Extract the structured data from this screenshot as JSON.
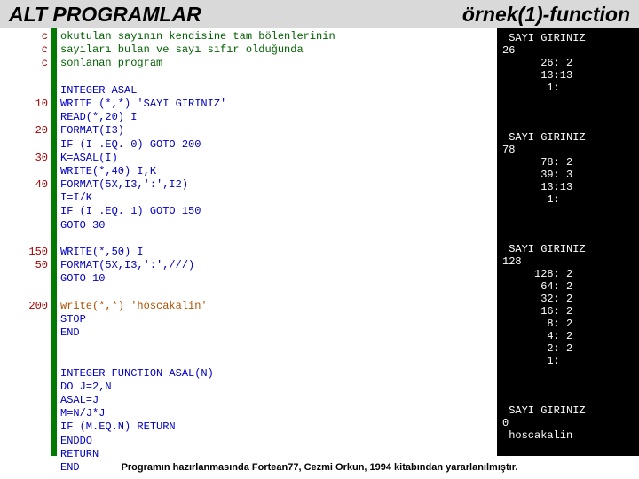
{
  "title": {
    "left": "ALT PROGRAMLAR",
    "right": "örnek(1)-function"
  },
  "gutter": [
    "c",
    "c",
    "c",
    "",
    "",
    "10",
    "",
    "20",
    "",
    "30",
    "",
    "40",
    "",
    "",
    "",
    "",
    "150",
    "50",
    "",
    "",
    "200",
    "",
    "",
    "",
    "",
    "",
    "",
    "",
    "",
    "",
    ""
  ],
  "code": [
    {
      "cls": "c-comment",
      "t": "okutulan sayının kendisine tam bölenlerinin"
    },
    {
      "cls": "c-comment",
      "t": "sayıları bulan ve sayı sıfır olduğunda"
    },
    {
      "cls": "c-comment",
      "t": "sonlanan program"
    },
    {
      "cls": "",
      "t": ""
    },
    {
      "cls": "c-kw",
      "t": "INTEGER ASAL"
    },
    {
      "cls": "c-kw",
      "t": "WRITE (*,*) 'SAYI GIRINIZ'"
    },
    {
      "cls": "c-kw",
      "t": "READ(*,20) I"
    },
    {
      "cls": "c-kw",
      "t": "FORMAT(I3)"
    },
    {
      "cls": "c-kw",
      "t": "IF (I .EQ. 0) GOTO 200"
    },
    {
      "cls": "c-kw",
      "t": "K=ASAL(I)"
    },
    {
      "cls": "c-kw",
      "t": "WRITE(*,40) I,K"
    },
    {
      "cls": "c-kw",
      "t": "FORMAT(5X,I3,':',I2)"
    },
    {
      "cls": "c-kw",
      "t": "I=I/K"
    },
    {
      "cls": "c-kw",
      "t": "IF (I .EQ. 1) GOTO 150"
    },
    {
      "cls": "c-kw",
      "t": "GOTO 30"
    },
    {
      "cls": "",
      "t": ""
    },
    {
      "cls": "c-kw",
      "t": "WRITE(*,50) I"
    },
    {
      "cls": "c-kw",
      "t": "FORMAT(5X,I3,':',///)"
    },
    {
      "cls": "c-kw",
      "t": "GOTO 10"
    },
    {
      "cls": "",
      "t": ""
    },
    {
      "cls": "c-func",
      "t": "write(*,*) 'hoscakalin'"
    },
    {
      "cls": "c-kw",
      "t": "STOP"
    },
    {
      "cls": "c-kw",
      "t": "END"
    },
    {
      "cls": "",
      "t": ""
    },
    {
      "cls": "",
      "t": ""
    },
    {
      "cls": "c-kw",
      "t": "INTEGER FUNCTION ASAL(N)"
    },
    {
      "cls": "c-kw",
      "t": "DO J=2,N"
    },
    {
      "cls": "c-kw",
      "t": "ASAL=J"
    },
    {
      "cls": "c-kw",
      "t": "M=N/J*J"
    },
    {
      "cls": "c-kw",
      "t": "IF (M.EQ.N) RETURN"
    },
    {
      "cls": "c-kw",
      "t": "ENDDO"
    },
    {
      "cls": "c-kw",
      "t": "RETURN"
    },
    {
      "cls": "c-kw",
      "t": "END"
    }
  ],
  "output": " SAYI GIRINIZ\n26\n      26: 2\n      13:13\n       1:\n\n\n\n SAYI GIRINIZ\n78\n      78: 2\n      39: 3\n      13:13\n       1:\n\n\n\n SAYI GIRINIZ\n128\n     128: 2\n      64: 2\n      32: 2\n      16: 2\n       8: 2\n       4: 2\n       2: 2\n       1:\n\n\n\n SAYI GIRINIZ\n0\n hoscakalin",
  "footer": "Programın hazırlanmasında Fortean77, Cezmi Orkun, 1994 kitabından yararlanılmıştır."
}
